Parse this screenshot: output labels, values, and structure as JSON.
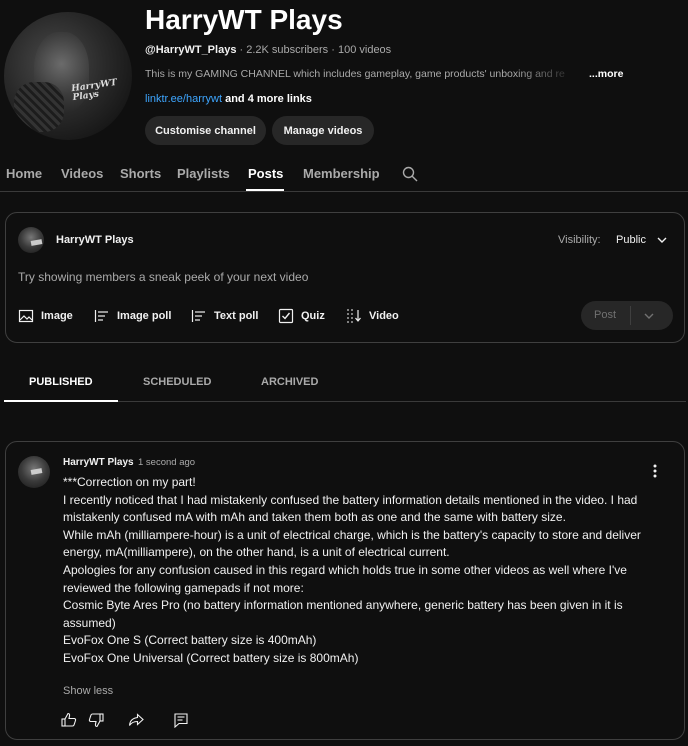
{
  "channel": {
    "name": "HarryWT Plays",
    "avatar_text": "HarryWT\nPlays",
    "handle": "@HarryWT_Plays",
    "subscribers": "2.2K subscribers",
    "videos": "100 videos",
    "description": "This is my GAMING CHANNEL which includes gameplay, game products' unboxing and re",
    "more_label": "...more",
    "link": "linktr.ee/harrywt",
    "more_links": "and 4 more links",
    "customize_label": "Customise channel",
    "manage_label": "Manage videos"
  },
  "tabs": [
    "Home",
    "Videos",
    "Shorts",
    "Playlists",
    "Posts",
    "Membership"
  ],
  "active_tab": "Posts",
  "composer": {
    "author": "HarryWT Plays",
    "visibility_label": "Visibility:",
    "visibility_value": "Public",
    "placeholder": "Try showing members a sneak peek of your next video",
    "tools": [
      "Image",
      "Image poll",
      "Text poll",
      "Quiz",
      "Video"
    ],
    "post_label": "Post"
  },
  "subtabs": [
    "PUBLISHED",
    "SCHEDULED",
    "ARCHIVED"
  ],
  "active_subtab": "PUBLISHED",
  "post": {
    "author": "HarryWT Plays",
    "time": "1 second ago",
    "lines": [
      "***Correction on my part!",
      "I recently noticed that I had mistakenly confused the battery information details mentioned in the video. I had mistakenly confused mA with mAh and taken them both as one and the same with battery size.",
      "While mAh (milliampere-hour) is a unit of electrical charge, which is the battery's capacity to store and deliver energy, mA(milliampere), on the other hand, is a unit of electrical current.",
      "Apologies for any confusion caused in this regard which holds true in some other videos as well where I've reviewed the following gamepads if not more:",
      "Cosmic Byte Ares Pro (no battery information mentioned anywhere, generic battery has been given in it is assumed)",
      "EvoFox One S (Correct battery size is 400mAh)",
      "EvoFox One Universal (Correct battery size is 800mAh)"
    ],
    "show_less": "Show less"
  },
  "colors": {
    "background": "#0f0f0f",
    "surface": "#272727",
    "border": "#3f3f3f",
    "link": "#3ea6ff",
    "muted": "#aaaaaa"
  }
}
